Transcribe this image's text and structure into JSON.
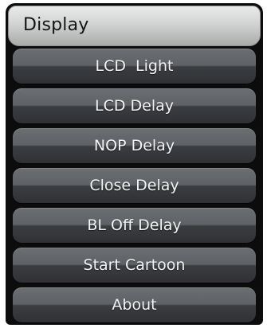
{
  "title": "Display",
  "menu": {
    "items": [
      {
        "label": "LCD  Light"
      },
      {
        "label": "LCD Delay"
      },
      {
        "label": "NOP Delay"
      },
      {
        "label": "Close Delay"
      },
      {
        "label": "BL Off Delay"
      },
      {
        "label": "Start Cartoon"
      },
      {
        "label": "About"
      }
    ]
  },
  "colors": {
    "screen_background": "#0c0c0c",
    "title_bar": "#d2d3d3",
    "button_top": "#6b6e72",
    "button_bottom": "#2f3134",
    "button_text": "#f4f4f4"
  }
}
